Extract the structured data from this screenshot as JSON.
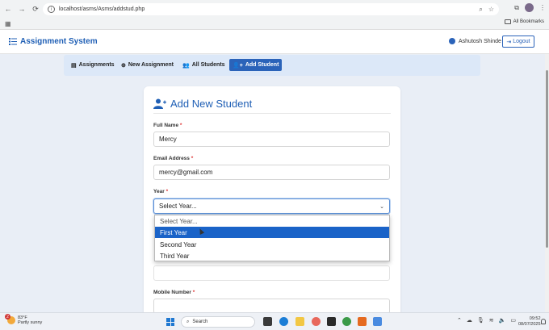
{
  "browser": {
    "url": "localhost/asms/Asms/addstud.php",
    "bookmarks_label": "All Bookmarks"
  },
  "app": {
    "brand": "Assignment System",
    "user_name": "Ashutosh Shinde",
    "logout_label": "Logout"
  },
  "nav": {
    "items": [
      {
        "label": "Assignments"
      },
      {
        "label": "New Assignment"
      },
      {
        "label": "All Students"
      },
      {
        "label": "Add Student",
        "active": true
      }
    ]
  },
  "form": {
    "title": "Add New Student",
    "required_mark": "*",
    "full_name_label": "Full Name",
    "full_name_value": "Mercy",
    "email_label": "Email Address",
    "email_value": "mercy@gmail.com",
    "year_label": "Year",
    "year_value": "Select Year...",
    "year_options": [
      "Select Year...",
      "First Year",
      "Second Year",
      "Third Year"
    ],
    "year_highlighted": "First Year",
    "mobile_label": "Mobile Number"
  },
  "taskbar": {
    "weather_temp": "83°F",
    "weather_desc": "Partly sunny",
    "weather_badge": "2",
    "search_placeholder": "Search",
    "time": "09:52",
    "date": "08/07/2025"
  },
  "colors": {
    "accent": "#2b63b9",
    "highlight": "#1a63c8",
    "nav_bg": "#dce8f8"
  }
}
